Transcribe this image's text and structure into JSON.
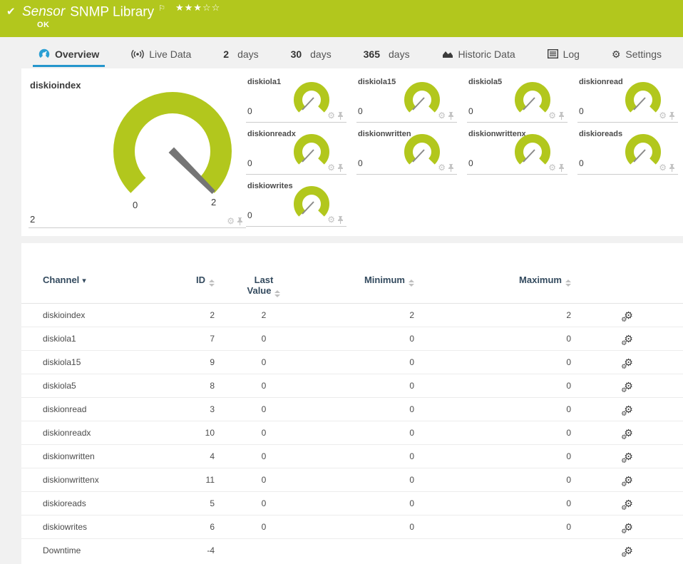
{
  "colors": {
    "header_green": "#b2c71d",
    "gauge_green": "#b2c71d",
    "active_tab_blue": "#2596cc",
    "needle_gray": "#757575"
  },
  "header": {
    "check_icon": "✔",
    "title_prefix": "Sensor",
    "title": "SNMP Library",
    "flag_icon": "⚐",
    "stars_filled": "★★★",
    "stars_empty": "☆☆",
    "status": "OK"
  },
  "tabs": [
    {
      "label": "Overview"
    },
    {
      "label": "Live Data"
    },
    {
      "num": "2",
      "label": "days"
    },
    {
      "num": "30",
      "label": "days"
    },
    {
      "num": "365",
      "label": "days"
    },
    {
      "label": "Historic Data"
    },
    {
      "label": "Log"
    },
    {
      "label": "Settings"
    }
  ],
  "gauges": {
    "primary": {
      "name": "diskioindex",
      "value": "2",
      "scale_min": "0",
      "scale_max": "2"
    },
    "small": [
      {
        "name": "diskiola1",
        "value": "0"
      },
      {
        "name": "diskiola15",
        "value": "0"
      },
      {
        "name": "diskiola5",
        "value": "0"
      },
      {
        "name": "diskionread",
        "value": "0"
      },
      {
        "name": "diskionreadx",
        "value": "0"
      },
      {
        "name": "diskionwritten",
        "value": "0"
      },
      {
        "name": "diskionwrittenx",
        "value": "0"
      },
      {
        "name": "diskioreads",
        "value": "0"
      },
      {
        "name": "diskiowrites",
        "value": "0"
      }
    ],
    "gear_icon": "⚙"
  },
  "table": {
    "columns": [
      "Channel",
      "ID",
      "Last Value",
      "Minimum",
      "Maximum"
    ],
    "sort_caret": "▾",
    "gear_icon": "⚙",
    "rows": [
      {
        "channel": "diskioindex",
        "id": "2",
        "last": "2",
        "min": "2",
        "max": "2"
      },
      {
        "channel": "diskiola1",
        "id": "7",
        "last": "0",
        "min": "0",
        "max": "0"
      },
      {
        "channel": "diskiola15",
        "id": "9",
        "last": "0",
        "min": "0",
        "max": "0"
      },
      {
        "channel": "diskiola5",
        "id": "8",
        "last": "0",
        "min": "0",
        "max": "0"
      },
      {
        "channel": "diskionread",
        "id": "3",
        "last": "0",
        "min": "0",
        "max": "0"
      },
      {
        "channel": "diskionreadx",
        "id": "10",
        "last": "0",
        "min": "0",
        "max": "0"
      },
      {
        "channel": "diskionwritten",
        "id": "4",
        "last": "0",
        "min": "0",
        "max": "0"
      },
      {
        "channel": "diskionwrittenx",
        "id": "11",
        "last": "0",
        "min": "0",
        "max": "0"
      },
      {
        "channel": "diskioreads",
        "id": "5",
        "last": "0",
        "min": "0",
        "max": "0"
      },
      {
        "channel": "diskiowrites",
        "id": "6",
        "last": "0",
        "min": "0",
        "max": "0"
      },
      {
        "channel": "Downtime",
        "id": "-4",
        "last": "",
        "min": "",
        "max": ""
      }
    ]
  }
}
